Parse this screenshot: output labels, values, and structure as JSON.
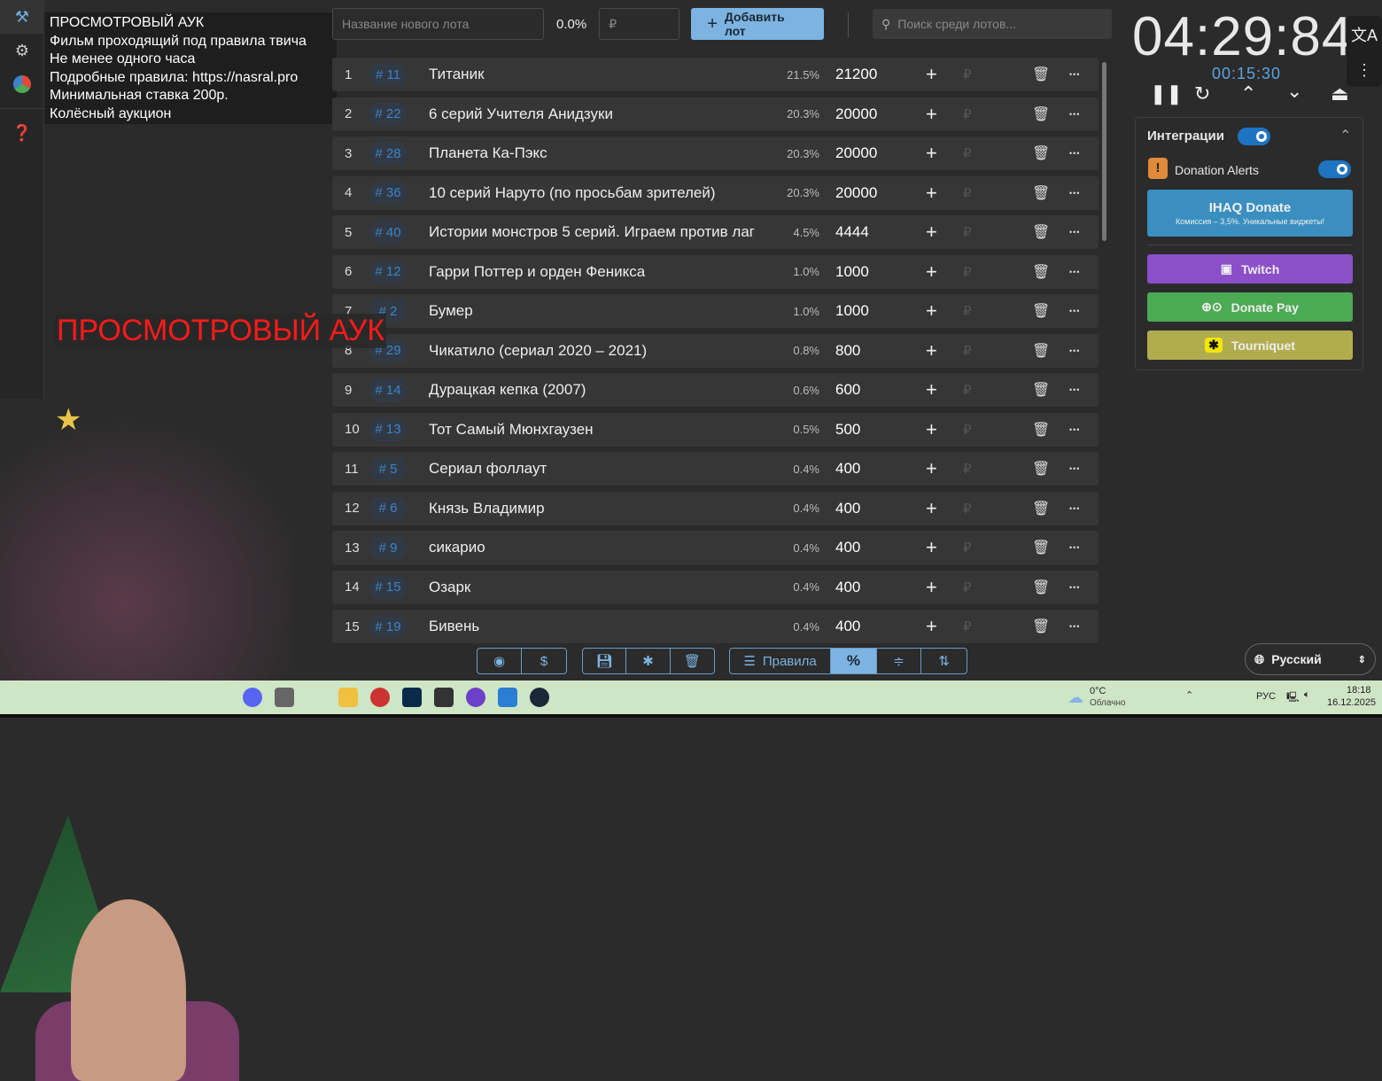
{
  "sidebar": {
    "items": [
      {
        "icon": "gavel-icon"
      },
      {
        "icon": "gear-icon"
      },
      {
        "icon": "pie-chart-icon"
      },
      {
        "icon": "help-icon"
      }
    ]
  },
  "overlay": {
    "lines": [
      "ПРОСМОТРОВЫЙ АУК",
      "Фильм проходящий под правила твича",
      "Не менее одного часа",
      "Подробные правила: https://nasral.pro",
      "Минимальная ставка 200р.",
      "Колёсный аукцион"
    ],
    "big_title": "ПРОСМОТРОВЫЙ АУК"
  },
  "topbar": {
    "name_placeholder": "Название нового лота",
    "percent": "0.0%",
    "amount_placeholder": "₽",
    "add_label": "Добавить лот",
    "search_placeholder": "Поиск среди лотов..."
  },
  "lots": [
    {
      "n": "1",
      "id": "# 11",
      "name": "Титаник",
      "pct": "21.5%",
      "amount": "21200"
    },
    {
      "n": "2",
      "id": "# 22",
      "name": "6 серий Учителя Анидзуки",
      "pct": "20.3%",
      "amount": "20000"
    },
    {
      "n": "3",
      "id": "# 28",
      "name": "Планета Ка-Пэкс",
      "pct": "20.3%",
      "amount": "20000"
    },
    {
      "n": "4",
      "id": "# 36",
      "name": "10 серий Наруто (по просьбам зрителей)",
      "pct": "20.3%",
      "amount": "20000"
    },
    {
      "n": "5",
      "id": "# 40",
      "name": "Истории монстров 5 серий. Играем против лаг",
      "pct": "4.5%",
      "amount": "4444"
    },
    {
      "n": "6",
      "id": "# 12",
      "name": "Гарри Поттер и орден Феникса",
      "pct": "1.0%",
      "amount": "1000"
    },
    {
      "n": "7",
      "id": "# 2",
      "name": "Бумер",
      "pct": "1.0%",
      "amount": "1000"
    },
    {
      "n": "8",
      "id": "# 29",
      "name": "Чикатило (сериал 2020 – 2021)",
      "pct": "0.8%",
      "amount": "800"
    },
    {
      "n": "9",
      "id": "# 14",
      "name": "Дурацкая кепка (2007)",
      "pct": "0.6%",
      "amount": "600"
    },
    {
      "n": "10",
      "id": "# 13",
      "name": "Тот Самый Мюнхгаузен",
      "pct": "0.5%",
      "amount": "500"
    },
    {
      "n": "11",
      "id": "# 5",
      "name": "Сериал фоллаут",
      "pct": "0.4%",
      "amount": "400"
    },
    {
      "n": "12",
      "id": "# 6",
      "name": "Князь Владимир",
      "pct": "0.4%",
      "amount": "400"
    },
    {
      "n": "13",
      "id": "# 9",
      "name": "сикарио",
      "pct": "0.4%",
      "amount": "400"
    },
    {
      "n": "14",
      "id": "# 15",
      "name": "Озарк",
      "pct": "0.4%",
      "amount": "400"
    },
    {
      "n": "15",
      "id": "# 19",
      "name": "Бивень",
      "pct": "0.4%",
      "amount": "400"
    }
  ],
  "timer": {
    "main": "04:29:84",
    "sub": "00:15:30"
  },
  "integrations": {
    "title": "Интеграции",
    "donation_alerts": "Donation Alerts",
    "ihaq": "IHAQ Donate",
    "ihaq_sub": "Комиссия – 3,5%. Уникальные виджеты!",
    "twitch": "Twitch",
    "donatepay": "Donate Pay",
    "tourniquet": "Tourniquet",
    "colors": {
      "ihaq": "#3a8fc0",
      "twitch": "#8a4fc9",
      "donatepay": "#4caa55",
      "tourniquet": "#b1ad4f"
    }
  },
  "bottom": {
    "rules_label": "Правила",
    "dollar": "$",
    "percent": "%"
  },
  "language": {
    "selected": "Русский"
  },
  "taskbar": {
    "temp": "0°C",
    "weather": "Облачно",
    "lang": "РУС",
    "time": "18:18",
    "date": "16.12.2025"
  }
}
